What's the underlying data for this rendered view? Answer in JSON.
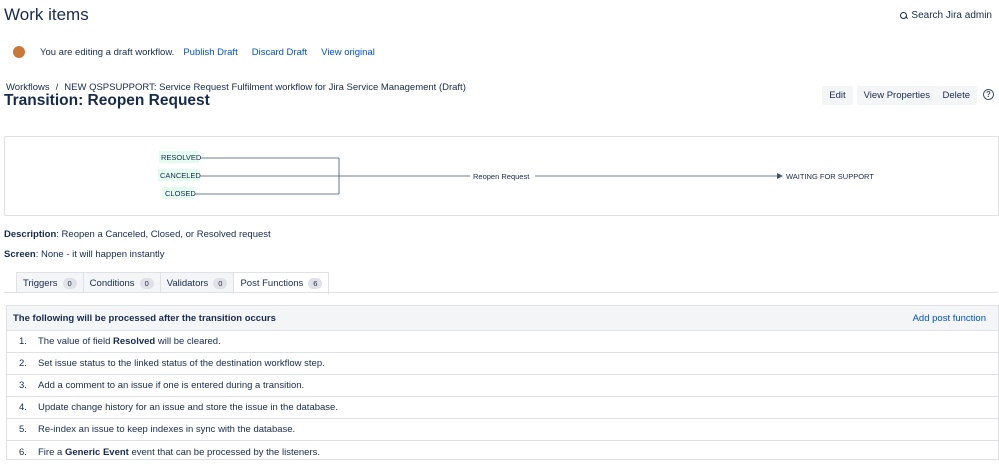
{
  "header": {
    "title": "Work items",
    "search_admin": "Search Jira admin"
  },
  "draft_bar": {
    "message": "You are editing a draft workflow.",
    "publish": "Publish Draft",
    "discard": "Discard Draft",
    "view_original": "View original",
    "dot_color": "#c7783a"
  },
  "breadcrumb": {
    "root": "Workflows",
    "separator": "/",
    "current": "NEW QSPSUPPORT: Service Request Fulfilment workflow for Jira Service Management (Draft)"
  },
  "transition_title": "Transition: Reopen Request",
  "actions": {
    "edit": "Edit",
    "view_properties": "View Properties",
    "delete": "Delete"
  },
  "diagram": {
    "sources": [
      "RESOLVED",
      "CANCELED",
      "CLOSED"
    ],
    "transition": "Reopen Request",
    "destination": "WAITING FOR SUPPORT"
  },
  "description": {
    "label": "Description",
    "value": ": Reopen a Canceled, Closed, or Resolved request"
  },
  "screen": {
    "label": "Screen",
    "value": ": None - it will happen instantly"
  },
  "tabs": [
    {
      "label": "Triggers",
      "count": "0"
    },
    {
      "label": "Conditions",
      "count": "0"
    },
    {
      "label": "Validators",
      "count": "0"
    },
    {
      "label": "Post Functions",
      "count": "6"
    }
  ],
  "post_functions": {
    "heading": "The following will be processed after the transition occurs",
    "add_label": "Add post function",
    "items": [
      {
        "num": "1.",
        "pre": "The value of field ",
        "bold": "Resolved",
        "post": " will be cleared."
      },
      {
        "num": "2.",
        "pre": "Set issue status to the linked status of the destination workflow step.",
        "bold": "",
        "post": ""
      },
      {
        "num": "3.",
        "pre": "Add a comment to an issue if one is entered during a transition.",
        "bold": "",
        "post": ""
      },
      {
        "num": "4.",
        "pre": "Update change history for an issue and store the issue in the database.",
        "bold": "",
        "post": ""
      },
      {
        "num": "5.",
        "pre": "Re-index an issue to keep indexes in sync with the database.",
        "bold": "",
        "post": ""
      },
      {
        "num": "6.",
        "pre": "Fire a ",
        "bold": "Generic Event",
        "post": " event that can be processed by the listeners."
      }
    ]
  }
}
